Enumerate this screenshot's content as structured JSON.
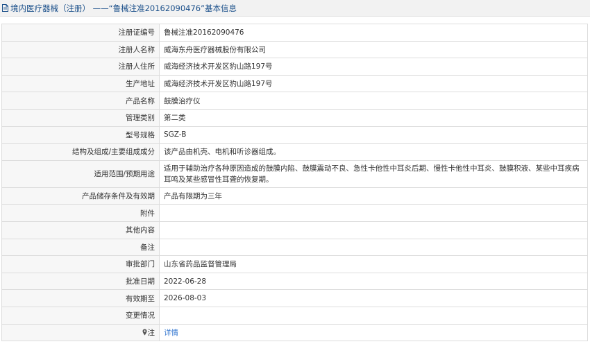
{
  "header": {
    "title": "境内医疗器械（注册） ——“鲁械注准20162090476”基本信息"
  },
  "rows": [
    {
      "label": "注册证编号",
      "value": "鲁械注准20162090476"
    },
    {
      "label": "注册人名称",
      "value": "威海东舟医疗器械股份有限公司"
    },
    {
      "label": "注册人住所",
      "value": "威海经济技术开发区豹山路197号"
    },
    {
      "label": "生产地址",
      "value": "威海经济技术开发区豹山路197号"
    },
    {
      "label": "产品名称",
      "value": "鼓膜治疗仪"
    },
    {
      "label": "管理类别",
      "value": "第二类"
    },
    {
      "label": "型号规格",
      "value": "SGZ-B"
    },
    {
      "label": "结构及组成/主要组成成分",
      "value": "该产品由机壳、电机和听诊器组成。"
    },
    {
      "label": "适用范围/预期用途",
      "value": "适用于辅助治疗各种原因造成的鼓膜内陷、鼓膜震动不良、急性卡他性中耳炎后期、慢性卡他性中耳炎、鼓膜积液、某些中耳疾病耳鸣及某些感冒性耳聋的恢复期。"
    },
    {
      "label": "产品储存条件及有效期",
      "value": "产品有限期为三年"
    },
    {
      "label": "附件",
      "value": ""
    },
    {
      "label": "其他内容",
      "value": ""
    },
    {
      "label": "备注",
      "value": ""
    },
    {
      "label": "审批部门",
      "value": "山东省药品监督管理局"
    },
    {
      "label": "批准日期",
      "value": "2022-06-28"
    },
    {
      "label": "有效期至",
      "value": "2026-08-03"
    },
    {
      "label": "变更情况",
      "value": ""
    }
  ],
  "note": {
    "label": "注",
    "link_text": "详情"
  },
  "colors": {
    "title_text": "#1a4f8a",
    "link": "#3b7bd1",
    "label_bg": "#f7f7f7",
    "border": "#dcdcdc"
  }
}
